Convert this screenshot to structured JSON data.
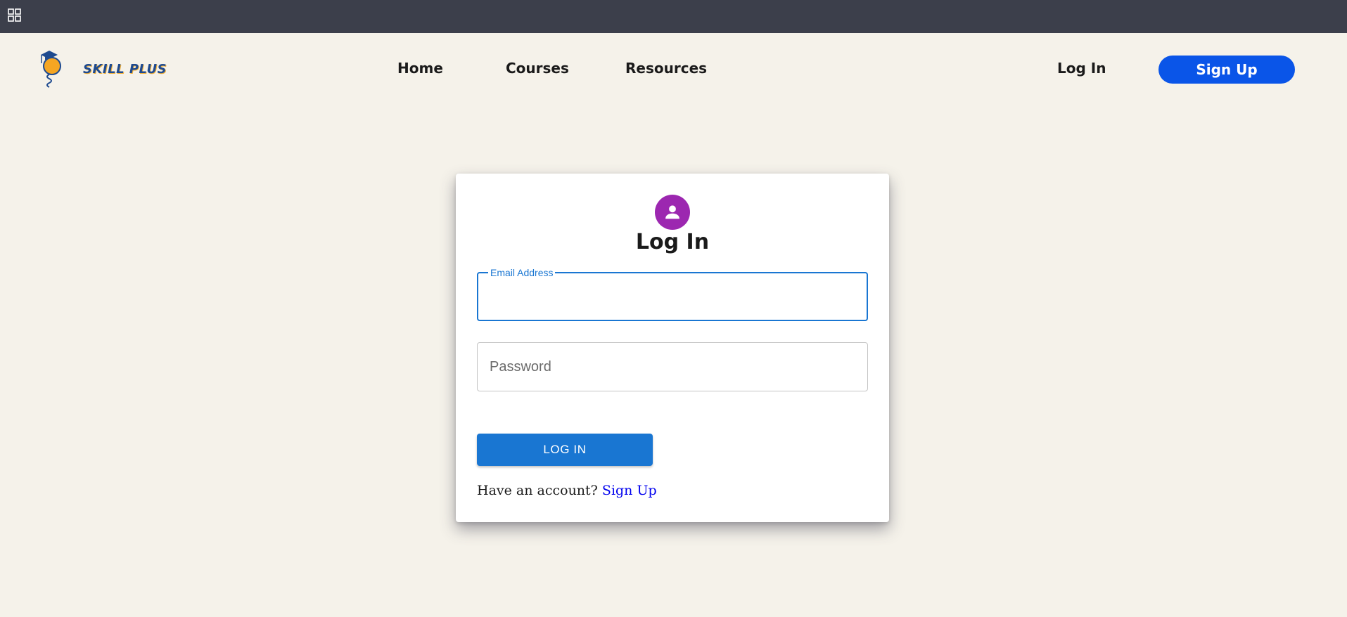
{
  "topbar": {
    "apps_icon": "grid-icon"
  },
  "header": {
    "brand": "SKILL PLUS",
    "logo_icon": "lightbulb-graduation-cap-logo",
    "nav": [
      {
        "label": "Home"
      },
      {
        "label": "Courses"
      },
      {
        "label": "Resources"
      }
    ],
    "login_label": "Log In",
    "signup_label": "Sign Up"
  },
  "login_card": {
    "avatar_icon": "person-icon",
    "title": "Log In",
    "email": {
      "label": "Email Address",
      "value": ""
    },
    "password": {
      "placeholder": "Password",
      "value": ""
    },
    "submit_label": "LOG IN",
    "footer_text": "Have an account?",
    "footer_link": "Sign Up"
  },
  "colors": {
    "background": "#f5f2ea",
    "topbar": "#3c3f4b",
    "primary": "#1976d2",
    "signup_button": "#0a55e8",
    "avatar": "#9c27b0",
    "link": "#0000ee"
  }
}
